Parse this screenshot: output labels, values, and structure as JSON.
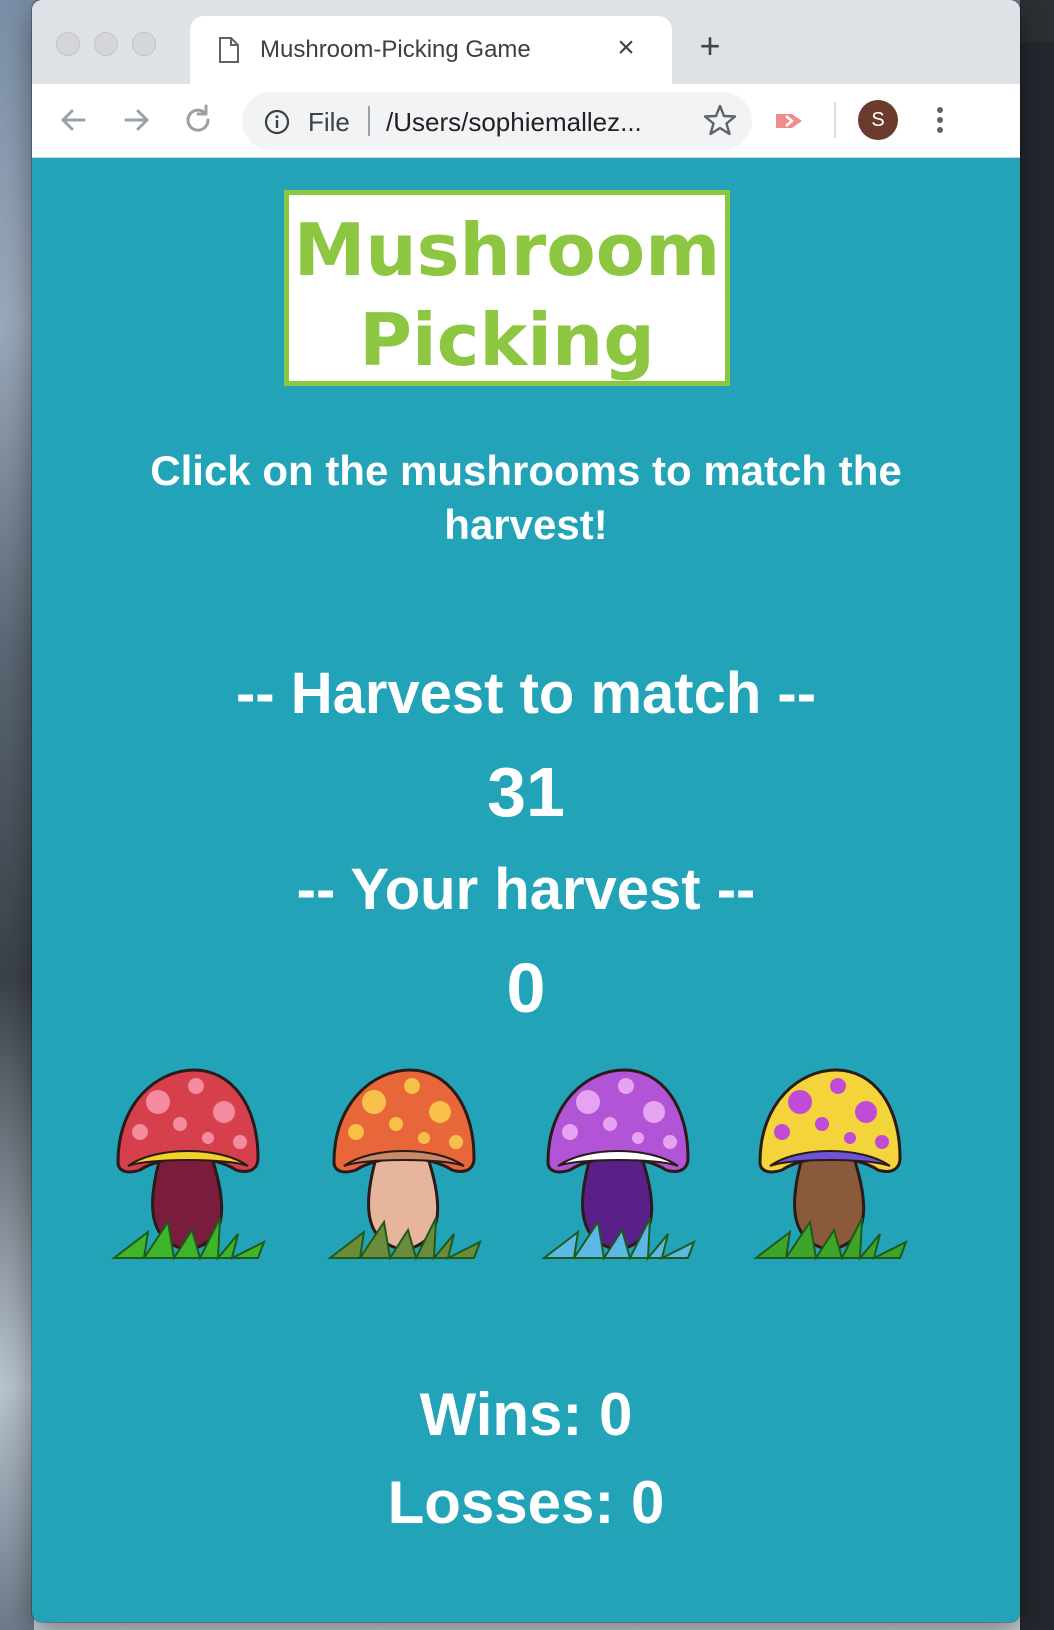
{
  "browser": {
    "tab_title": "Mushroom-Picking Game",
    "close_label": "×",
    "new_tab_label": "+",
    "address_scheme": "File",
    "address_url": "/Users/sophiemallez...",
    "avatar_initial": "S",
    "icons": [
      "document-icon",
      "back-arrow-icon",
      "forward-arrow-icon",
      "reload-icon",
      "info-icon",
      "star-icon",
      "extension-icon",
      "menu-dots-icon"
    ]
  },
  "game": {
    "title_line1": "Mushroom",
    "title_line2": "Picking",
    "instructions": "Click on the mushrooms to match the harvest!",
    "target_label": "-- Harvest to match --",
    "target_value": "31",
    "harvest_label": "-- Your harvest --",
    "harvest_value": "0",
    "wins_label": "Wins: 0",
    "losses_label": "Losses: 0",
    "mushrooms": [
      {
        "name": "red-mushroom",
        "cap": "#d6404c",
        "spots": "#f58ba0",
        "stem": "#7a1c3b",
        "grass": "#3fb62a",
        "ring": "#f2d22a"
      },
      {
        "name": "orange-mushroom",
        "cap": "#e8673a",
        "spots": "#f6c04a",
        "stem": "#e6b59c",
        "grass": "#6b8c3a",
        "ring": "#c98a6a"
      },
      {
        "name": "purple-mushroom",
        "cap": "#b154d6",
        "spots": "#e6a3f2",
        "stem": "#5b1f8a",
        "grass": "#5cb8e6",
        "ring": "#ffffff"
      },
      {
        "name": "yellow-mushroom",
        "cap": "#f3d43a",
        "spots": "#c04bd6",
        "stem": "#8a5a3a",
        "grass": "#3fa52a",
        "ring": "#6b55d6"
      }
    ]
  },
  "colors": {
    "page_bg": "#23a3b7",
    "title_green": "#8dc641"
  }
}
